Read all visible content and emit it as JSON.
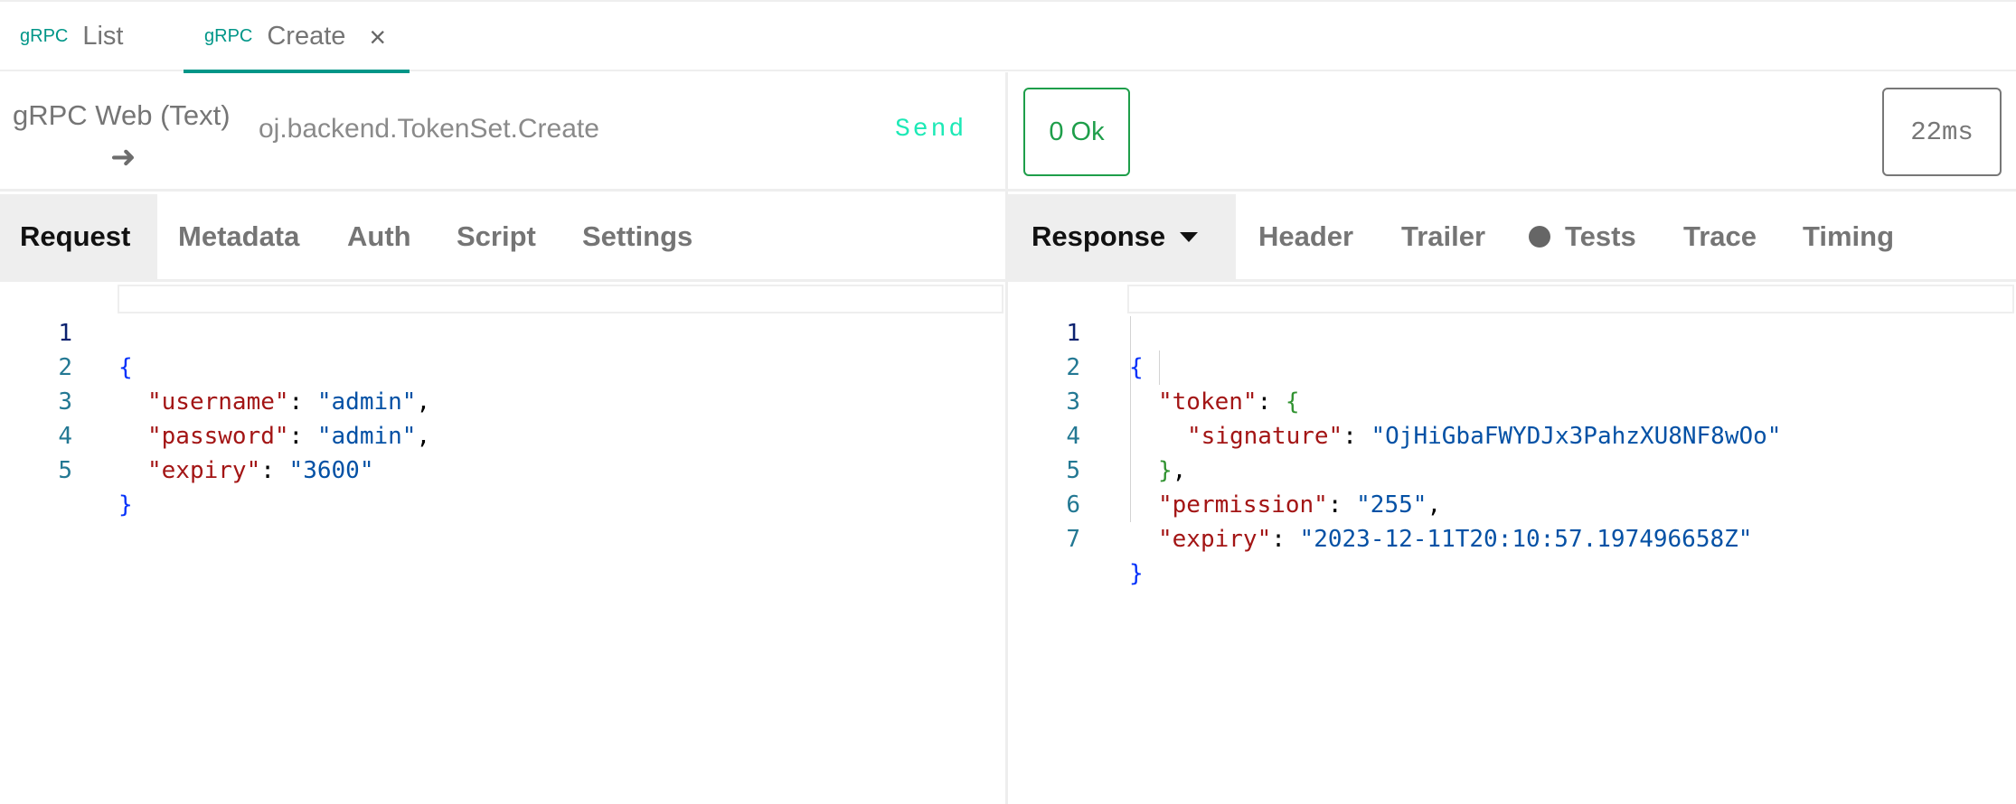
{
  "tabs": [
    {
      "protocol": "gRPC",
      "label": "List"
    },
    {
      "protocol": "gRPC",
      "label": "Create",
      "close": "×"
    }
  ],
  "request": {
    "method": "gRPC Web (Text)",
    "url": "oj.backend.TokenSet.Create",
    "send_label": "Send",
    "tabs": [
      "Request",
      "Metadata",
      "Auth",
      "Script",
      "Settings"
    ],
    "body": {
      "line_numbers": [
        "1",
        "2",
        "3",
        "4",
        "5"
      ],
      "fields": [
        {
          "key": "\"username\"",
          "value": "\"admin\""
        },
        {
          "key": "\"password\"",
          "value": "\"admin\""
        },
        {
          "key": "\"expiry\"",
          "value": "\"3600\""
        }
      ]
    }
  },
  "response": {
    "status": "0 Ok",
    "time": "22ms",
    "tabs": [
      "Response",
      "Header",
      "Trailer",
      "Tests",
      "Trace",
      "Timing"
    ],
    "body": {
      "line_numbers": [
        "1",
        "2",
        "3",
        "4",
        "5",
        "6",
        "7"
      ],
      "token_key": "\"token\"",
      "signature_key": "\"signature\"",
      "signature_value": "\"OjHiGbaFWYDJx3PahzXU8NF8wOo\"",
      "permission_key": "\"permission\"",
      "permission_value": "\"255\"",
      "expiry_key": "\"expiry\"",
      "expiry_value": "\"2023-12-11T20:10:57.197496658Z\""
    }
  },
  "colors": {
    "accent": "#009688",
    "send": "#1de9b6",
    "status_ok": "#1e9e4a",
    "json_key": "#a31515",
    "json_string": "#0451a5",
    "bracket_level1": "#0431fa",
    "bracket_level2": "#319331"
  }
}
